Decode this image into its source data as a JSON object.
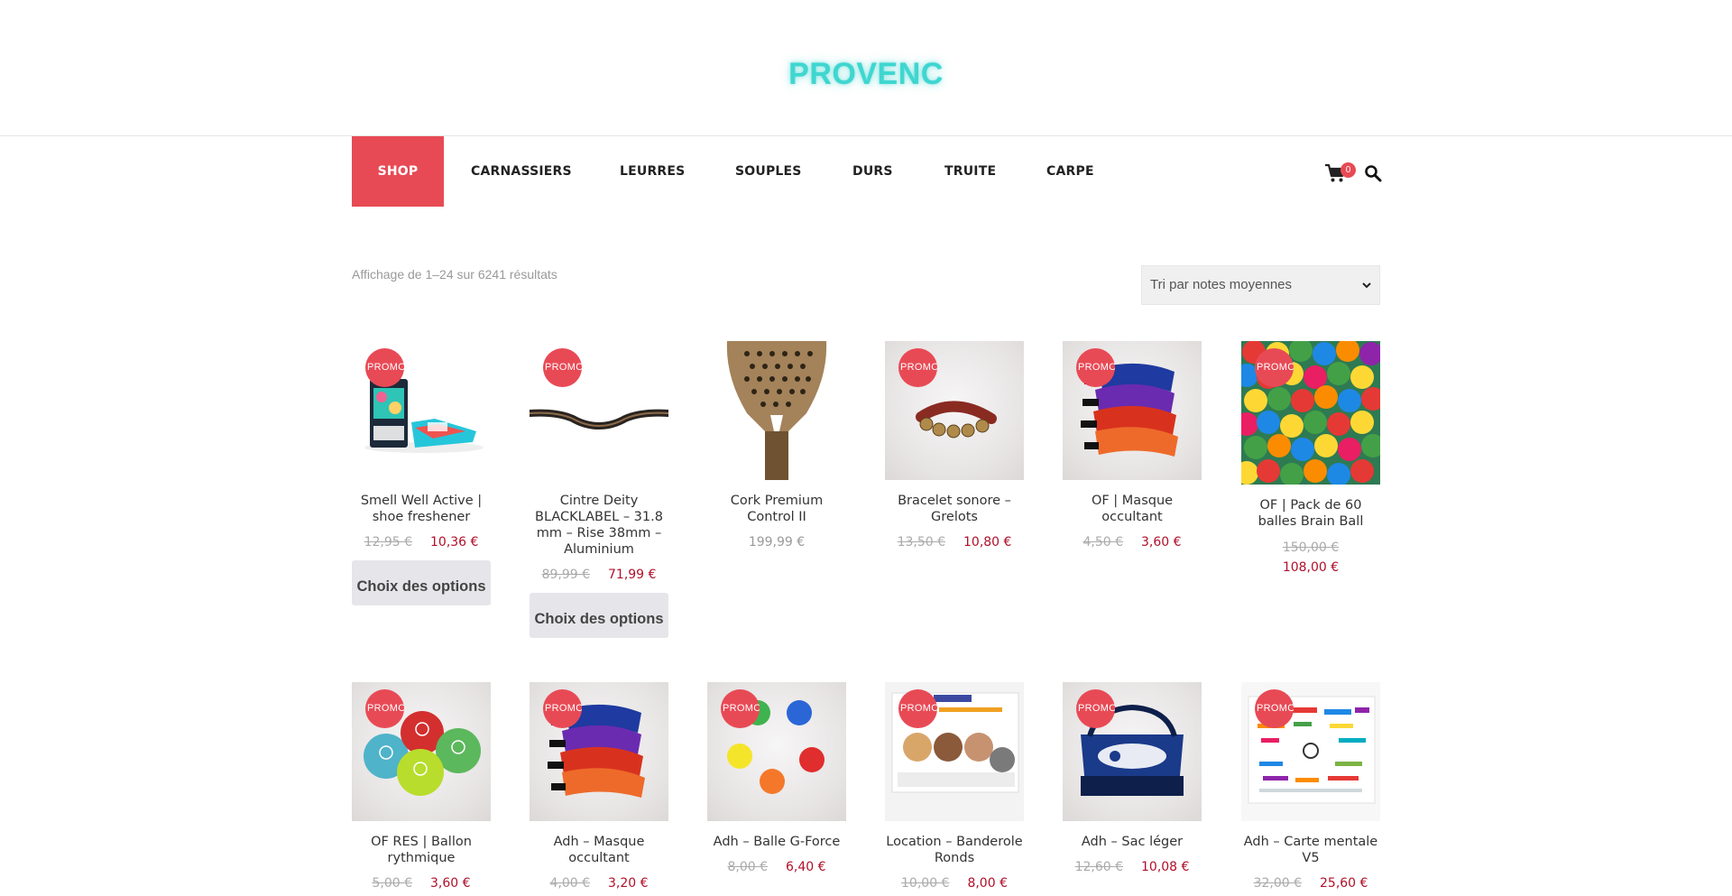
{
  "site": {
    "logo": "PROVENC"
  },
  "nav": {
    "items": [
      "SHOP",
      "CARNASSIERS",
      "LEURRES",
      "SOUPLES",
      "DURS",
      "TRUITE",
      "CARPE"
    ],
    "cart_count": "0",
    "accent_color": "#e84a55"
  },
  "shop": {
    "result_count": "Affichage de 1–24 sur 6241 résultats",
    "sort_selected": "Tri par notes moyennes"
  },
  "promo_label": "PROMO",
  "products": [
    {
      "title": "Smell Well Active | shoe freshener",
      "old_price": "12,95 €",
      "price": "10,36 €",
      "button": "Choix des options",
      "promo": true
    },
    {
      "title": "Cintre Deity BLACKLABEL – 31.8 mm – Rise 38mm – Aluminium",
      "old_price": "89,99 €",
      "price": "71,99 €",
      "button": "Choix des options",
      "promo": true
    },
    {
      "title": "Cork Premium Control II",
      "price": "199,99 €",
      "promo": false
    },
    {
      "title": "Bracelet sonore – Grelots",
      "old_price": "13,50 €",
      "price": "10,80 €",
      "promo": true
    },
    {
      "title": "OF | Masque occultant",
      "old_price": "4,50 €",
      "price": "3,60 €",
      "promo": true
    },
    {
      "title": "OF | Pack de 60 balles Brain Ball",
      "old_price": "150,00 €",
      "price": "108,00 €",
      "promo": true
    },
    {
      "title": "OF RES | Ballon rythmique",
      "old_price": "5,00 €",
      "price": "3,60 €",
      "promo": true
    },
    {
      "title": "Adh – Masque occultant",
      "old_price": "4,00 €",
      "price": "3,20 €",
      "promo": true
    },
    {
      "title": "Adh – Balle G-Force",
      "old_price": "8,00 €",
      "price": "6,40 €",
      "promo": true
    },
    {
      "title": "Location – Banderole Ronds",
      "old_price": "10,00 €",
      "price": "8,00 €",
      "promo": true
    },
    {
      "title": "Adh – Sac léger",
      "old_price": "12,60 €",
      "price": "10,08 €",
      "promo": true
    },
    {
      "title": "Adh – Carte mentale V5",
      "old_price": "32,00 €",
      "price": "25,60 €",
      "promo": true
    }
  ]
}
